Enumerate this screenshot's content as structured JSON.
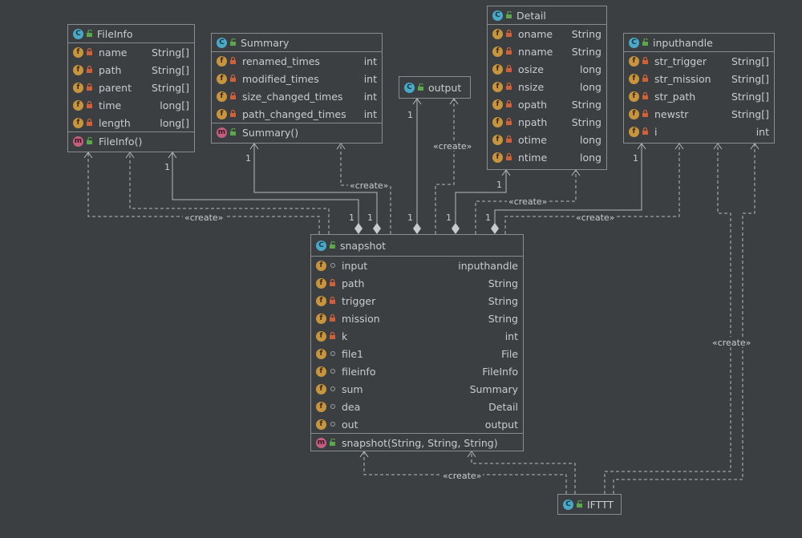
{
  "classes": {
    "fileinfo": {
      "name": "FileInfo",
      "fields": [
        {
          "name": "name",
          "type": "String[]"
        },
        {
          "name": "path",
          "type": "String[]"
        },
        {
          "name": "parent",
          "type": "String[]"
        },
        {
          "name": "time",
          "type": "long[]"
        },
        {
          "name": "length",
          "type": "long[]"
        }
      ],
      "method": "FileInfo()"
    },
    "summary": {
      "name": "Summary",
      "fields": [
        {
          "name": "renamed_times",
          "type": "int"
        },
        {
          "name": "modified_times",
          "type": "int"
        },
        {
          "name": "size_changed_times",
          "type": "int"
        },
        {
          "name": "path_changed_times",
          "type": "int"
        }
      ],
      "method": "Summary()"
    },
    "output": {
      "name": "output"
    },
    "detail": {
      "name": "Detail",
      "fields": [
        {
          "name": "oname",
          "type": "String"
        },
        {
          "name": "nname",
          "type": "String"
        },
        {
          "name": "osize",
          "type": "long"
        },
        {
          "name": "nsize",
          "type": "long"
        },
        {
          "name": "opath",
          "type": "String"
        },
        {
          "name": "npath",
          "type": "String"
        },
        {
          "name": "otime",
          "type": "long"
        },
        {
          "name": "ntime",
          "type": "long"
        }
      ]
    },
    "inputhandle": {
      "name": "inputhandle",
      "fields": [
        {
          "name": "str_trigger",
          "type": "String[]"
        },
        {
          "name": "str_mission",
          "type": "String[]"
        },
        {
          "name": "str_path",
          "type": "String[]"
        },
        {
          "name": "newstr",
          "type": "String[]"
        },
        {
          "name": "i",
          "type": "int"
        }
      ]
    },
    "snapshot": {
      "name": "snapshot",
      "fields": [
        {
          "name": "input",
          "type": "inputhandle"
        },
        {
          "name": "path",
          "type": "String"
        },
        {
          "name": "trigger",
          "type": "String"
        },
        {
          "name": "mission",
          "type": "String"
        },
        {
          "name": "k",
          "type": "int"
        },
        {
          "name": "file1",
          "type": "File"
        },
        {
          "name": "fileinfo",
          "type": "FileInfo"
        },
        {
          "name": "sum",
          "type": "Summary"
        },
        {
          "name": "dea",
          "type": "Detail"
        },
        {
          "name": "out",
          "type": "output"
        }
      ],
      "method": "snapshot(String, String, String)"
    },
    "ifttt": {
      "name": "IFTTT"
    }
  },
  "labels": {
    "create": "«create»",
    "one": "1"
  },
  "icons": {
    "class": "C",
    "field": "f",
    "method": "m"
  },
  "colors": {
    "background": "#3c3f41",
    "border": "#888c8f",
    "text": "#c9cccf",
    "class_badge": "#4aa8c8",
    "field_badge": "#c7953d",
    "method_badge": "#c35f7e",
    "private_lock": "#d0603a",
    "public_lock": "#5aa84a"
  }
}
